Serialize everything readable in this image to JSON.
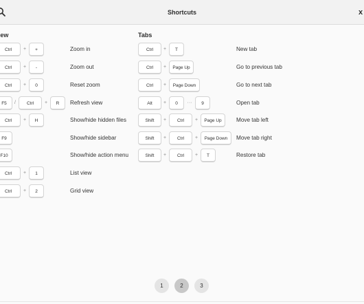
{
  "header": {
    "title": "Shortcuts",
    "close_label": "x"
  },
  "sections": {
    "left_title": "View",
    "right_title": "Tabs"
  },
  "view_rows": [
    {
      "keys": [
        "Ctrl",
        "+"
      ],
      "seps": [
        "+"
      ],
      "label": "Zoom in"
    },
    {
      "keys": [
        "Ctrl",
        "-"
      ],
      "seps": [
        "+"
      ],
      "label": "Zoom out"
    },
    {
      "keys": [
        "Ctrl",
        "0"
      ],
      "seps": [
        "+"
      ],
      "label": "Reset zoom"
    },
    {
      "keys": [
        "F5",
        "Ctrl",
        "R"
      ],
      "seps": [
        "/",
        "+"
      ],
      "label": "Refresh view"
    },
    {
      "keys": [
        "Ctrl",
        "H"
      ],
      "seps": [
        "+"
      ],
      "label": "Show/hide hidden files"
    },
    {
      "keys": [
        "F9"
      ],
      "seps": [],
      "label": "Show/hide sidebar"
    },
    {
      "keys": [
        "F10"
      ],
      "seps": [],
      "label": "Show/hide action menu"
    },
    {
      "keys": [
        "Ctrl",
        "1"
      ],
      "seps": [
        "+"
      ],
      "label": "List view"
    },
    {
      "keys": [
        "Ctrl",
        "2"
      ],
      "seps": [
        "+"
      ],
      "label": "Grid view"
    }
  ],
  "tab_rows": [
    {
      "keys": [
        "Ctrl",
        "T"
      ],
      "seps": [
        "+"
      ],
      "label": "New tab"
    },
    {
      "keys": [
        "Ctrl",
        "Page Up"
      ],
      "seps": [
        "+"
      ],
      "label": "Go to previous tab"
    },
    {
      "keys": [
        "Ctrl",
        "Page Down"
      ],
      "seps": [
        "+"
      ],
      "label": "Go to next tab"
    },
    {
      "keys": [
        "Alt",
        "0",
        "9"
      ],
      "seps": [
        "+",
        "···"
      ],
      "label": "Open tab"
    },
    {
      "keys": [
        "Shift",
        "Ctrl",
        "Page Up"
      ],
      "seps": [
        "+",
        "+"
      ],
      "label": "Move tab left"
    },
    {
      "keys": [
        "Shift",
        "Ctrl",
        "Page Down"
      ],
      "seps": [
        "+",
        "+"
      ],
      "label": "Move tab right"
    },
    {
      "keys": [
        "Shift",
        "Ctrl",
        "T"
      ],
      "seps": [
        "+",
        "+"
      ],
      "label": "Restore tab"
    }
  ],
  "pagination": {
    "pages": [
      "1",
      "2",
      "3"
    ],
    "current": "2"
  }
}
